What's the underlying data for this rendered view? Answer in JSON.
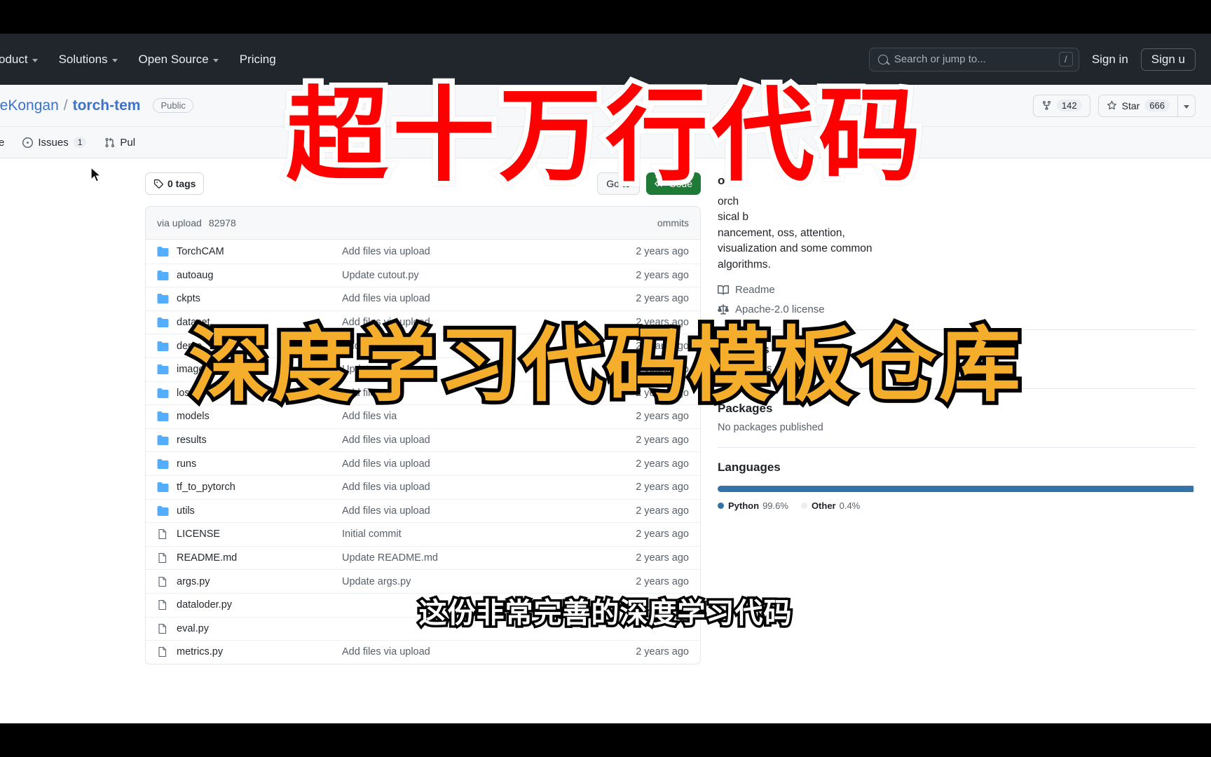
{
  "header": {
    "nav_items": [
      {
        "label": "oduct",
        "has_caret": true
      },
      {
        "label": "Solutions",
        "has_caret": true
      },
      {
        "label": "Open Source",
        "has_caret": true
      },
      {
        "label": "Pricing",
        "has_caret": false
      }
    ],
    "search_placeholder": "Search or jump to...",
    "search_shortcut": "/",
    "sign_in": "Sign in",
    "sign_up": "Sign u",
    "background": "#21262d"
  },
  "repo": {
    "owner": "geKongan",
    "separator": "/",
    "name": "torch-tem",
    "visibility": "Public",
    "fork_count": "142",
    "star_label": "Star",
    "star_count": "666"
  },
  "tabs": [
    {
      "label": "e",
      "icon": "code-icon",
      "count": ""
    },
    {
      "label": "Issues",
      "icon": "issue-icon",
      "count": "1"
    },
    {
      "label": "Pul",
      "icon": "pull-request-icon",
      "count": ""
    }
  ],
  "branch_bar": {
    "tags_count": "0 tags",
    "go_to_file": "Go to",
    "code_button": "Code"
  },
  "commit_bar": {
    "message": "via upload",
    "sha": "82978",
    "commits_label": "ommits"
  },
  "files": [
    {
      "name": "TorchCAM",
      "type": "folder",
      "message": "Add files via upload",
      "age": "2 years ago"
    },
    {
      "name": "autoaug",
      "type": "folder",
      "message": "Update cutout.py",
      "age": "2 years ago"
    },
    {
      "name": "ckpts",
      "type": "folder",
      "message": "Add files via upload",
      "age": "2 years ago"
    },
    {
      "name": "dataset",
      "type": "folder",
      "message": "Add files via upload",
      "age": "2 years ago"
    },
    {
      "name": "demo",
      "type": "folder",
      "message": "Add files via upload",
      "age": "2 years ago"
    },
    {
      "name": "images",
      "type": "folder",
      "message": "Update",
      "age": "2 years ago"
    },
    {
      "name": "loss",
      "type": "folder",
      "message": "Add files via",
      "age": "2 years ago"
    },
    {
      "name": "models",
      "type": "folder",
      "message": "Add files via",
      "age": "2 years ago"
    },
    {
      "name": "results",
      "type": "folder",
      "message": "Add files via upload",
      "age": "2 years ago"
    },
    {
      "name": "runs",
      "type": "folder",
      "message": "Add files via upload",
      "age": "2 years ago"
    },
    {
      "name": "tf_to_pytorch",
      "type": "folder",
      "message": "Add files via upload",
      "age": "2 years ago"
    },
    {
      "name": "utils",
      "type": "folder",
      "message": "Add files via upload",
      "age": "2 years ago"
    },
    {
      "name": "LICENSE",
      "type": "file",
      "message": "Initial commit",
      "age": "2 years ago"
    },
    {
      "name": "README.md",
      "type": "file",
      "message": "Update README.md",
      "age": "2 years ago"
    },
    {
      "name": "args.py",
      "type": "file",
      "message": "Update args.py",
      "age": "2 years ago"
    },
    {
      "name": "dataloder.py",
      "type": "file",
      "message": "",
      "age": ""
    },
    {
      "name": "eval.py",
      "type": "file",
      "message": "",
      "age": ""
    },
    {
      "name": "metrics.py",
      "type": "file",
      "message": "Add files via upload",
      "age": "2 years ago"
    }
  ],
  "sidebar": {
    "about_title": "out",
    "about_desc_line1": "orch",
    "about_desc_line2": "sical b",
    "about_desc_line3": "nancement,          oss, attention,",
    "about_desc_line4": "visualization and some common",
    "about_desc_line5": "algorithms.",
    "readme_link": "Readme",
    "license_link": "Apache-2.0 license",
    "releases_title": "Releases",
    "releases_empty": "No releases published",
    "packages_title": "Packages",
    "packages_empty": "No packages published",
    "languages_title": "Languages",
    "languages": [
      {
        "name": "Python",
        "percent": "99.6%",
        "color": "#3572A5",
        "width": 99.6
      },
      {
        "name": "Other",
        "percent": "0.4%",
        "color": "#ededed",
        "width": 0.4
      }
    ]
  },
  "overlays": {
    "headline": "超十万行代码",
    "subhead": "深度学习代码模板仓库",
    "caption": "这份非常完善的深度学习代码",
    "headline_color": "#ff0000",
    "subhead_color": "#f5ae2c",
    "caption_color": "#ffffff"
  }
}
